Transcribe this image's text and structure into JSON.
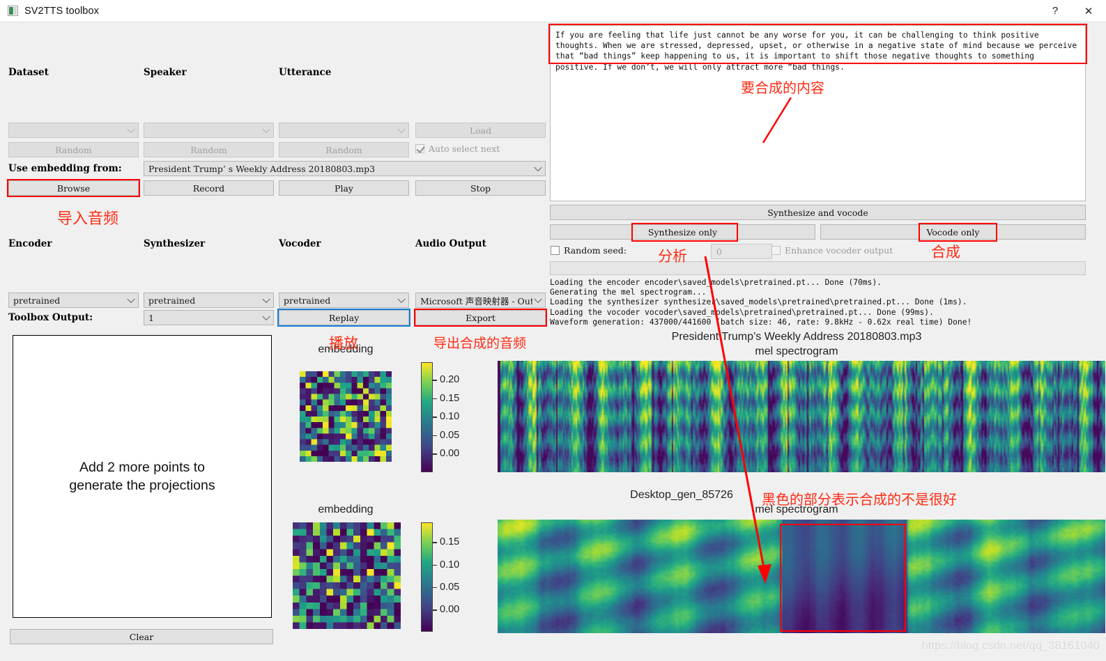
{
  "window": {
    "title": "SV2TTS toolbox",
    "help_label": "?",
    "close_label": "✕",
    "app_icon": "app-icon"
  },
  "browse_panel": {
    "labels": {
      "dataset": "Dataset",
      "speaker": "Speaker",
      "utterance": "Utterance"
    },
    "dataset_combo": "",
    "speaker_combo": "",
    "utterance_combo": "",
    "load_button": "Load",
    "random_dataset": "Random",
    "random_speaker": "Random",
    "random_utterance": "Random",
    "auto_select_next": "Auto select next",
    "use_embedding_from": "Use embedding from:",
    "embedding_source": "President Trump’ s Weekly Address 20180803.mp3",
    "browse_button": "Browse",
    "record_button": "Record",
    "play_button": "Play",
    "stop_button": "Stop"
  },
  "models_panel": {
    "labels": {
      "encoder": "Encoder",
      "synthesizer": "Synthesizer",
      "vocoder": "Vocoder",
      "audio_output": "Audio Output"
    },
    "encoder_combo": "pretrained",
    "synthesizer_combo": "pretrained",
    "vocoder_combo": "pretrained",
    "audio_output_combo": "Microsoft 声音映射器 - Outpu",
    "toolbox_output_label": "Toolbox Output:",
    "toolbox_output_combo": "1",
    "replay_button": "Replay",
    "export_button": "Export",
    "clear_button": "Clear"
  },
  "generation_panel": {
    "text_input": "If you are feeling that life just cannot be any worse for you, it can be challenging to think positive thoughts. When we are stressed, depressed, upset, or otherwise in a negative state of mind because we perceive that “bad things” keep happening to us, it is important to shift those negative thoughts to something positive. If we don’t, we will only attract more “bad things.",
    "synthesize_and_vocode": "Synthesize and vocode",
    "synthesize_only": "Synthesize only",
    "vocode_only": "Vocode only",
    "random_seed_label": "Random seed:",
    "seed_value": "0",
    "enhance_vocoder_output": "Enhance vocoder output",
    "log_lines": [
      "Loading the encoder encoder\\saved_models\\pretrained.pt... Done (70ms).",
      "Generating the mel spectrogram...",
      "Loading the synthesizer synthesizer\\saved_models\\pretrained\\pretrained.pt... Done (1ms).",
      "Loading the vocoder vocoder\\saved_models\\pretrained\\pretrained.pt... Done (99ms).",
      "Waveform generation: 437000/441600 (batch size: 46, rate: 9.8kHz - 0.62x real time) Done!"
    ]
  },
  "projection": {
    "message": "Add 2 more points to\ngenerate the projections",
    "message_line1": "Add 2 more points to",
    "message_line2": "generate the projections"
  },
  "plots": {
    "embedding_top_title": "embedding",
    "embedding_bottom_title": "embedding",
    "spectrogram_top_title": "President Trump’s Weekly Address 20180803.mp3\nmel spectrogram",
    "spectrogram_top_title_line1": "President Trump’s Weekly Address 20180803.mp3",
    "spectrogram_top_title_line2": "mel spectrogram",
    "spectrogram_bottom_title_line1": "Desktop_gen_85726",
    "spectrogram_bottom_title_line2": "mel spectrogram",
    "colorbar_top_ticks": [
      "0.20",
      "0.15",
      "0.10",
      "0.05",
      "0.00"
    ],
    "colorbar_bottom_ticks": [
      "0.15",
      "0.10",
      "0.05",
      "0.00"
    ]
  },
  "annotations": {
    "import_audio": "导入音频",
    "content_to_synthesize": "要合成的内容",
    "analyze": "分析",
    "synthesize": "合成",
    "playback": "播放",
    "export_audio": "导出合成的音频",
    "black_region_note": "黑色的部分表示合成的不是很好",
    "highlight_color": "#ff0000",
    "accent_blue": "#1a7fd4"
  },
  "watermark": {
    "text": "https://blog.csdn.net/qq_38161040"
  }
}
